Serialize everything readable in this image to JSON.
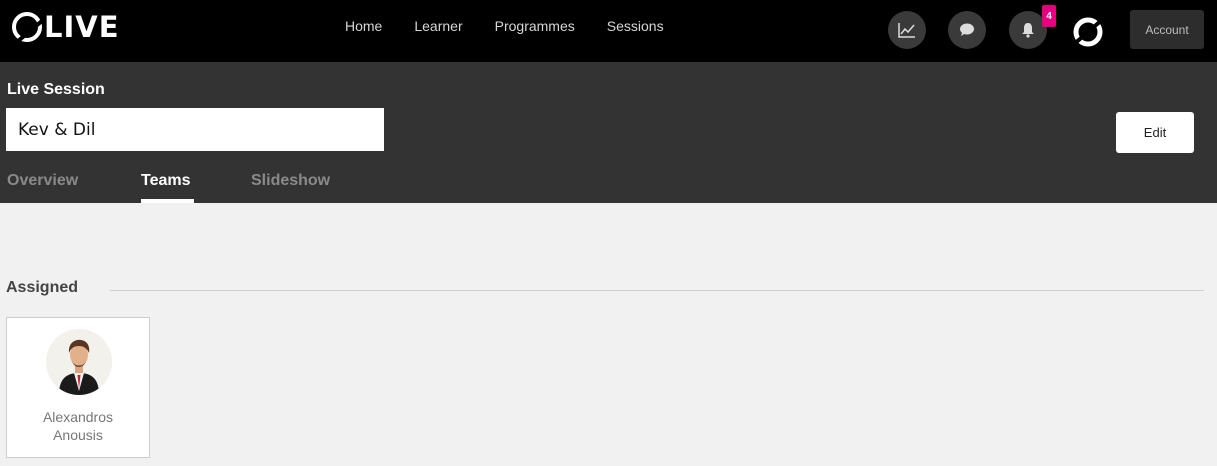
{
  "brand": {
    "name": "LIVE",
    "logo_letter": "O"
  },
  "nav": [
    {
      "label": "Home"
    },
    {
      "label": "Learner"
    },
    {
      "label": "Programmes"
    },
    {
      "label": "Sessions"
    }
  ],
  "toolbar": {
    "notification_count": "4",
    "account_label": "Account"
  },
  "session": {
    "heading": "Live Session",
    "name": "Kev & Dil",
    "edit_label": "Edit"
  },
  "tabs": [
    {
      "label": "Overview",
      "active": false
    },
    {
      "label": "Teams",
      "active": true
    },
    {
      "label": "Slideshow",
      "active": false
    }
  ],
  "assigned": {
    "label": "Assigned",
    "members": [
      {
        "name": "Alexandros Anousis"
      }
    ]
  },
  "colors": {
    "topbar": "#000000",
    "header": "#333333",
    "badge": "#e6007e",
    "page": "#f1f1f1"
  }
}
